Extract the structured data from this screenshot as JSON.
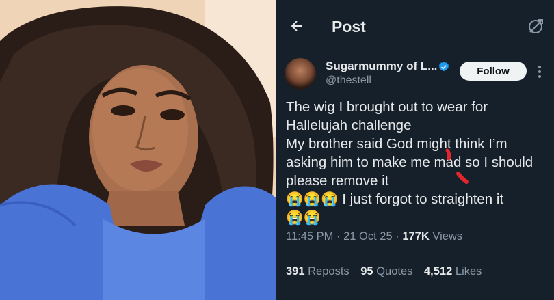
{
  "post": {
    "header_title": "Post",
    "author": {
      "display_name": "Sugarmummy of L...",
      "handle": "@thestell_",
      "verified": true
    },
    "follow_label": "Follow",
    "text_lines": [
      "The wig I brought out to wear for",
      "Hallelujah challenge",
      "My brother said God might think I’m",
      "asking him to make me mad so I should",
      "please remove it",
      "😭😭😭 I just forgot to straighten it",
      "😭😭"
    ],
    "time": "11:45 PM",
    "date": "21 Oct 25",
    "views_count": "177K",
    "views_label": "Views",
    "reposts_count": "391",
    "reposts_label": "Reposts",
    "quotes_count": "95",
    "quotes_label": "Quotes",
    "likes_count": "4,512",
    "likes_label": "Likes"
  },
  "icons": {
    "back": "arrow-left-icon",
    "grok": "grok-icon",
    "verified": "verified-badge-icon",
    "more": "more-vertical-icon"
  },
  "colors": {
    "background": "#15202b",
    "text": "#e7e9ea",
    "muted": "#8b98a5",
    "verified": "#1d9bf0",
    "follow_bg": "#eff3f4"
  }
}
